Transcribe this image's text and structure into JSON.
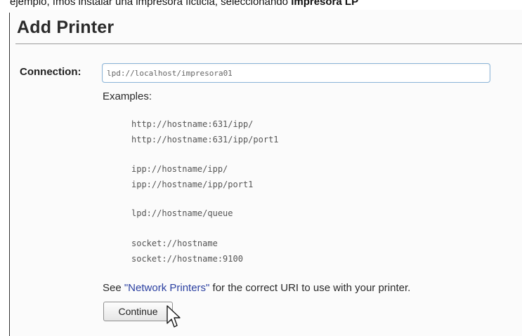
{
  "caption": {
    "lead": "ejemplo, fmos instalar una impresora ficticia, seleccionando ",
    "bold": "impresora LP"
  },
  "page": {
    "title": "Add Printer",
    "connection_label": "Connection:",
    "connection_value": "lpd://localhost/impresora01",
    "examples_label": "Examples:",
    "example_groups": [
      [
        "http://hostname:631/ipp/",
        "http://hostname:631/ipp/port1"
      ],
      [
        "ipp://hostname/ipp/",
        "ipp://hostname/ipp/port1"
      ],
      [
        "lpd://hostname/queue"
      ],
      [
        "socket://hostname",
        "socket://hostname:9100"
      ]
    ],
    "note_before": "See ",
    "note_link": "\"Network Printers\"",
    "note_after": " for the correct URI to use with your printer.",
    "continue_label": "Continue"
  },
  "icons": {
    "cursor": "mouse-pointer-icon"
  },
  "colors": {
    "link": "#2a3fa0",
    "input_border": "#8ab4d8"
  }
}
